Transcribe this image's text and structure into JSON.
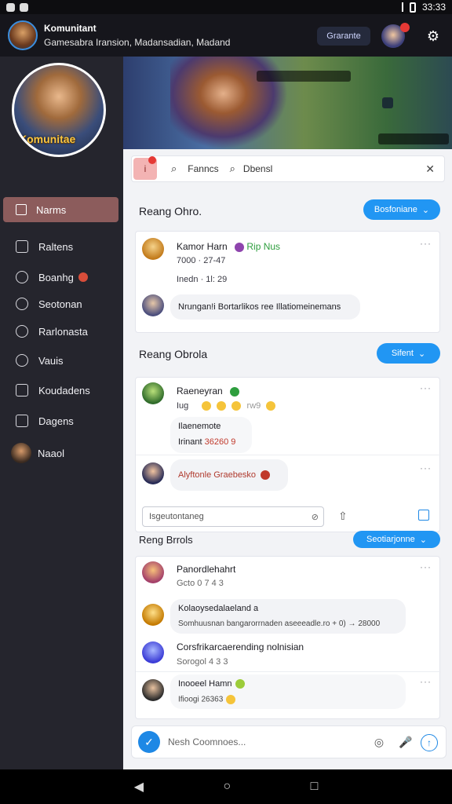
{
  "status_bar": {
    "time": "33:33"
  },
  "topbar": {
    "title": "Komunitant",
    "subtitle": "Gamesabra Iransion, Madansadian, Madand",
    "pill_label": "Grarante"
  },
  "sidebar": {
    "profile_tag": "Komunitae",
    "active_item": "Narms",
    "items": [
      {
        "label": "Raltens",
        "icon": "home-icon"
      },
      {
        "label": "Boanhg",
        "icon": "clock-icon",
        "badge": true
      },
      {
        "label": "Seotonan",
        "icon": "circle-icon"
      },
      {
        "label": "Rarlonasta",
        "icon": "clock-icon"
      },
      {
        "label": "Vauis",
        "icon": "pin-icon"
      },
      {
        "label": "Koudadens",
        "icon": "list-icon"
      },
      {
        "label": "Dagens",
        "icon": "folder-icon"
      },
      {
        "label": "Naaol",
        "icon": "avatar"
      }
    ]
  },
  "search": {
    "text1": "Fanncs",
    "text2": "Dbensl"
  },
  "section1": {
    "title": "Reang Ohro.",
    "pill": "Bosfoniane",
    "post": {
      "name": "Kamor Harn",
      "tag": "Rip Nus",
      "time": "7000 · 27-47",
      "detail": "Inedn · 1l: 29"
    },
    "reply": "Nrungan!i Bortarlikos ree Illatiomeinemans"
  },
  "section2": {
    "title": "Reang Obrola",
    "pill": "Sifent",
    "post": {
      "name": "Raeneyran",
      "meta": "Iug",
      "meta2": "rw9",
      "line1": "Ilaenemote",
      "line2_a": "Irinant",
      "line2_b": "36260 9"
    },
    "reply": "Alyftonle Graebesko",
    "compose_placeholder": "Isgeutontaneg"
  },
  "section3": {
    "title": "Reng Brrols",
    "pill": "Seotiarjonne",
    "rows": [
      {
        "name": "Panordlehahrt",
        "sub": "Gcto  0 7 4 3"
      },
      {
        "name": "Kolaoysedalaeland a",
        "sub": "Somhuusnan bangarorrnaden aseeeadle.ro + 0) → 28000"
      },
      {
        "name": "Corsfrikarcaerending nolnisian",
        "sub": "Sorogol  4 3 3"
      },
      {
        "name": "Inooeel Hamn",
        "sub": "Ifioogi 26363"
      }
    ]
  },
  "chat": {
    "placeholder": "Nesh Coomnoes..."
  },
  "colors": {
    "accent": "#2196f3",
    "active_nav": "#8c5c5c",
    "sidebar": "#25252d"
  }
}
